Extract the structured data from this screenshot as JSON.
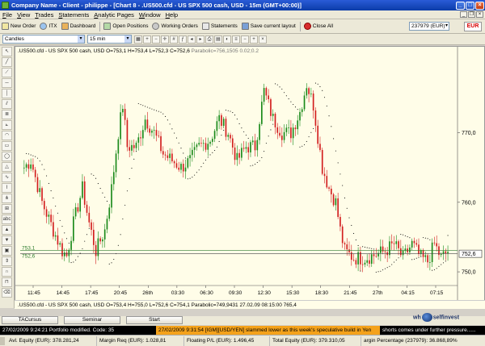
{
  "window": {
    "title": "Company Name - Client - philippe - [Chart 8 - .US500.cfd - US SPX 500 cash, USD - 15m (GMT+00:00)]"
  },
  "menu": [
    "File",
    "View",
    "Trades",
    "Statements",
    "Analytic Pages",
    "Window",
    "Help"
  ],
  "toolbar": {
    "items": [
      "New Order",
      "ITX",
      "Dashboard",
      "Open Positions",
      "Working Orders",
      "Statements",
      "Save current layout",
      "Close All"
    ],
    "account": "237979 (EUR)",
    "currency": "EUR"
  },
  "chart_toolbar": {
    "chart_type": "Candles",
    "timeframe": "15 min"
  },
  "chart_header": {
    "text": ".US500.cfd - US SPX 500 cash, USD  O=753,1  H=753,4  L=752,3  C=752,6",
    "indicator": "Parabolic=756,1505  0.02;0.2"
  },
  "chart_data": {
    "type": "candlestick",
    "symbol": ".US500.cfd",
    "timeframe": "15m",
    "y_axis_ticks": [
      "770,0",
      "760,0",
      "750,0"
    ],
    "ylim": [
      748.5,
      780.5
    ],
    "current_price_label": "752,6",
    "level_labels": [
      "753,1",
      "752,6"
    ],
    "x_axis_ticks": [
      "11:45",
      "14:45",
      "17:45",
      "20:45",
      "26th",
      "03:30",
      "06:30",
      "09:30",
      "12:30",
      "15:30",
      "18:30",
      "21:45",
      "27th",
      "04:15",
      "07:15"
    ],
    "indicator_name": "Parabolic SAR",
    "colors": {
      "up": "#1a8a1a",
      "down": "#d21e1e",
      "parabolic": "#000000",
      "background": "#fffde8"
    }
  },
  "info_bar": ".US500.cfd - US SPX 500 cash, USD  O=753,4  H=755,0  L=752,6  C=754,1  Parabolic=749,9431  27.02.09 08:15:00  765,4",
  "tabs": [
    "TACursus",
    "Seminar",
    "Start"
  ],
  "logo": {
    "left": "wh",
    "right": "selfinvest"
  },
  "status": {
    "left": "27/02/2009 9:24:21 Portfolio modified. Code: 35",
    "middle": "27/02/2009 9:31:54 [IGM][USD/YEN] slammed lower as this week's speculative build in Yen",
    "right": "shorts comes under further pressure......"
  },
  "accounts": [
    "Avl. Equity (EUR): 378.281,24",
    "Margin Req (EUR): 1.028,81",
    "Floating P/L (EUR): 1.496,45",
    "Total Equity (EUR): 379.310,05",
    "argin Percentage (237979): 36.868,89%"
  ]
}
